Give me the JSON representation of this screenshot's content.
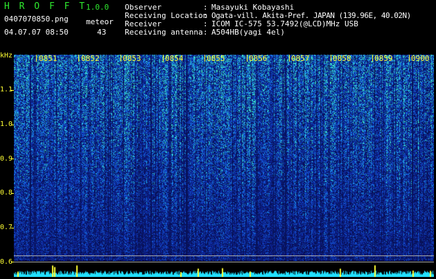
{
  "header": {
    "brand": "H R O F F T",
    "version": "1.0.0",
    "filename": "0407070850.png",
    "datetime": "04.07.07 08:50",
    "meteor_label": "meteor",
    "meteor_count": "43"
  },
  "info": {
    "observer_label": "Observer",
    "observer_value": "Masayuki Kobayashi",
    "location_label": "Receiving Location",
    "location_value": "Ogata-vill. Akita-Pref. JAPAN (139.96E, 40.02N)",
    "receiver_label": "Receiver",
    "receiver_value": "ICOM IC-575 53.7492(@LCD)MHz USB",
    "antenna_label": "Receiving antenna",
    "antenna_value": "A504HB(yagi 4el)",
    "separator": ":"
  },
  "axis": {
    "unit": "kHz",
    "y_ticks": [
      "1.1",
      "1.0",
      "0.9",
      "0.8",
      "0.7",
      "0.6"
    ],
    "time_ticks": [
      "0851",
      "0852",
      "0853",
      "0854",
      "0855",
      "0856",
      "0857",
      "0858",
      "0859",
      "0900"
    ]
  },
  "colors": {
    "brand": "#2ee82e",
    "text": "#ffffff",
    "axis": "#ffff33",
    "background": "#000000",
    "noise_dark": "#0a1466",
    "noise_bright": "#2ee6c8",
    "power_trace": "#22e0ff"
  }
}
